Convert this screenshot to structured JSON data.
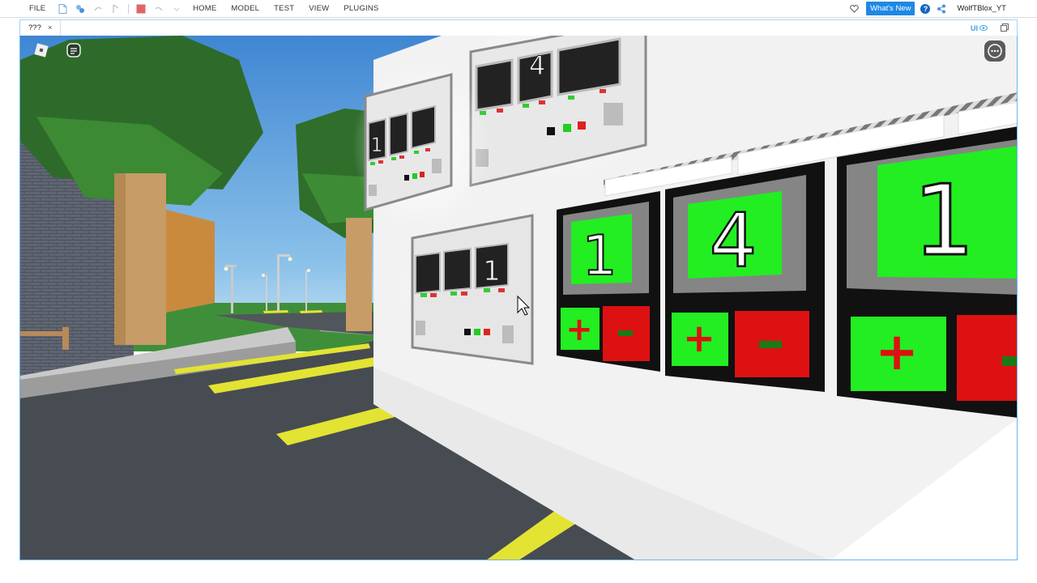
{
  "ribbon": {
    "file_label": "FILE",
    "menus": [
      "HOME",
      "MODEL",
      "TEST",
      "VIEW",
      "PLUGINS"
    ],
    "whats_new_label": "What's New",
    "help_label": "?",
    "username": "WolfTBlox_YT"
  },
  "tabs": [
    {
      "label": "???",
      "close": "×"
    }
  ],
  "tabbar_right": {
    "ui_toggle": "UI",
    "restore_icon": "restore-icon"
  },
  "viewport": {
    "counters": {
      "large": [
        "1",
        "4",
        "1"
      ],
      "mid_top": [
        "",
        "4",
        ""
      ],
      "left_top": [
        "1",
        "",
        ""
      ],
      "center_small": [
        "",
        "",
        "1"
      ]
    },
    "plus_label": "+",
    "minus_label": "-",
    "colors": {
      "sky": "#5aa0de",
      "grass": "#3b8f3b",
      "asphalt": "#4a4f55",
      "line_yellow": "#e5e536",
      "panel_green": "#22ee22",
      "panel_red": "#dd1111",
      "wall": "#f4f4f4"
    }
  }
}
